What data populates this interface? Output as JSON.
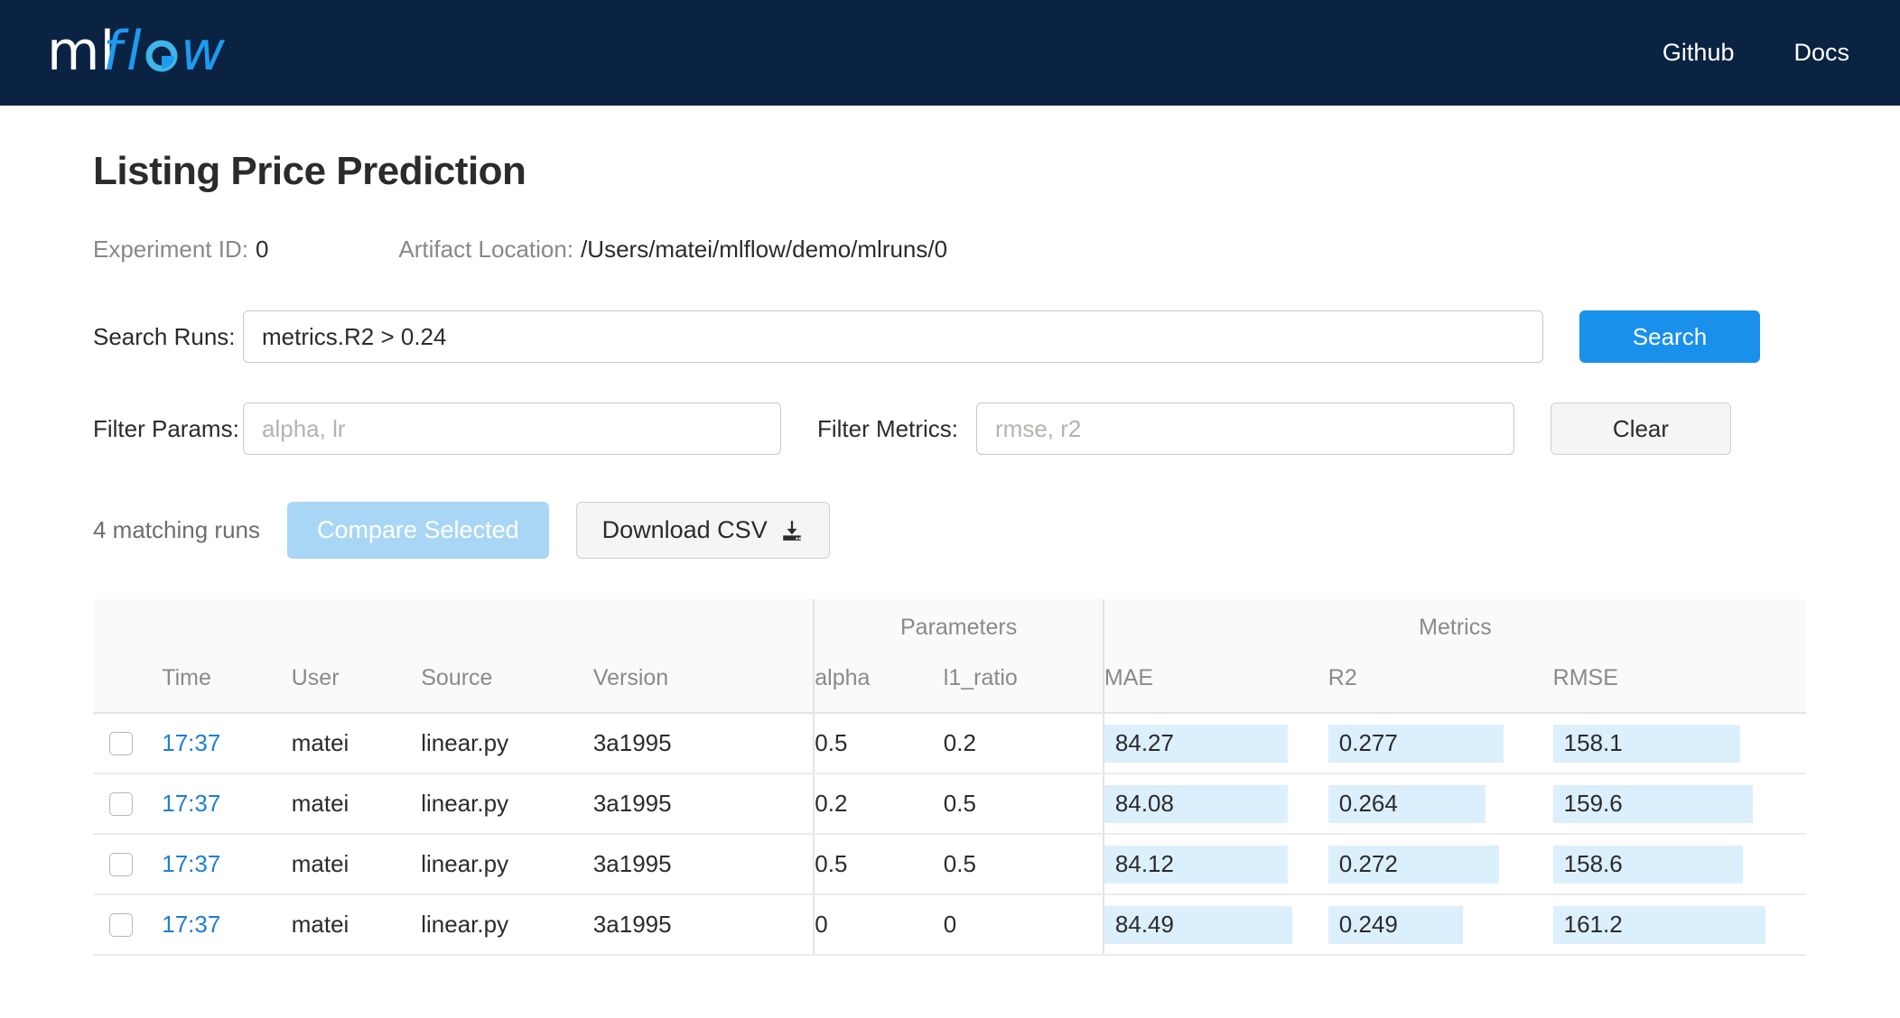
{
  "header": {
    "logo_ml": "ml",
    "logo_flow": "flow",
    "nav": [
      {
        "label": "Github",
        "name": "nav-link-github"
      },
      {
        "label": "Docs",
        "name": "nav-link-docs"
      }
    ],
    "bg_color": "#0b2343",
    "accent_color": "#1d9bf0"
  },
  "page": {
    "title": "Listing Price Prediction",
    "experiment_id_label": "Experiment ID:",
    "experiment_id_value": "0",
    "artifact_location_label": "Artifact Location:",
    "artifact_location_value": "/Users/matei/mlflow/demo/mlruns/0"
  },
  "search": {
    "runs_label": "Search Runs:",
    "runs_value": "metrics.R2 > 0.24",
    "runs_placeholder": "",
    "search_button": "Search",
    "clear_button": "Clear",
    "filter_params_label": "Filter Params:",
    "filter_params_value": "",
    "filter_params_placeholder": "alpha, lr",
    "filter_metrics_label": "Filter Metrics:",
    "filter_metrics_value": "",
    "filter_metrics_placeholder": "rmse, r2"
  },
  "actions": {
    "matching_runs": "4 matching runs",
    "compare_button": "Compare Selected",
    "download_button": "Download CSV",
    "download_icon": "download-icon",
    "compare_button_color": "#a9d6f5",
    "search_button_color": "#1890ec"
  },
  "table": {
    "group_headers": [
      {
        "label": "",
        "span": 5
      },
      {
        "label": "Parameters",
        "span": 2
      },
      {
        "label": "Metrics",
        "span": 3
      }
    ],
    "columns": [
      "",
      "Time",
      "User",
      "Source",
      "Version",
      "alpha",
      "l1_ratio",
      "MAE",
      "R2",
      "RMSE"
    ],
    "metric_highlight_color": "#dceffc",
    "link_color": "#1f7fd4",
    "rows": [
      {
        "checked": false,
        "time": "17:37",
        "user": "matei",
        "source": "linear.py",
        "version": "3a1995",
        "alpha": "0.5",
        "l1_ratio": "0.2",
        "mae": "84.27",
        "r2": "0.277",
        "rmse": "158.1",
        "mae_bar_pct": 82,
        "r2_bar_pct": 78,
        "rmse_bar_pct": 74
      },
      {
        "checked": false,
        "time": "17:37",
        "user": "matei",
        "source": "linear.py",
        "version": "3a1995",
        "alpha": "0.2",
        "l1_ratio": "0.5",
        "mae": "84.08",
        "r2": "0.264",
        "rmse": "159.6",
        "mae_bar_pct": 82,
        "r2_bar_pct": 70,
        "rmse_bar_pct": 79
      },
      {
        "checked": false,
        "time": "17:37",
        "user": "matei",
        "source": "linear.py",
        "version": "3a1995",
        "alpha": "0.5",
        "l1_ratio": "0.5",
        "mae": "84.12",
        "r2": "0.272",
        "rmse": "158.6",
        "mae_bar_pct": 82,
        "r2_bar_pct": 76,
        "rmse_bar_pct": 75
      },
      {
        "checked": false,
        "time": "17:37",
        "user": "matei",
        "source": "linear.py",
        "version": "3a1995",
        "alpha": "0",
        "l1_ratio": "0",
        "mae": "84.49",
        "r2": "0.249",
        "rmse": "161.2",
        "mae_bar_pct": 84,
        "r2_bar_pct": 60,
        "rmse_bar_pct": 84
      }
    ]
  }
}
